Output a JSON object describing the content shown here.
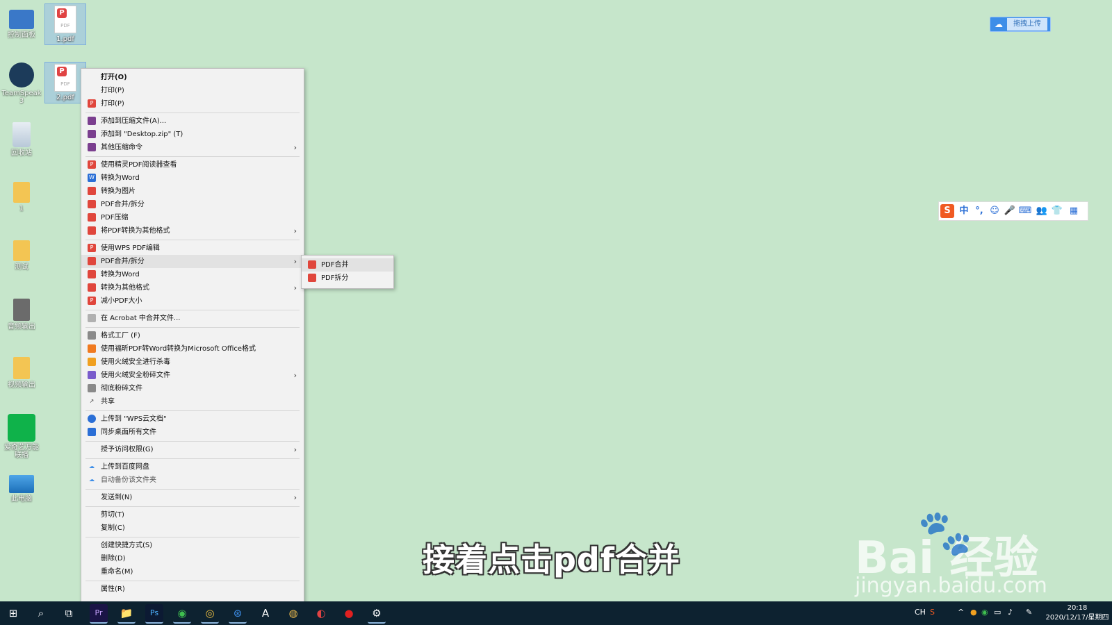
{
  "desktop_icons": [
    {
      "label": "控制面板",
      "icon": "control-panel-icon"
    },
    {
      "label": "1.pdf",
      "icon": "pdf-file-icon"
    },
    {
      "label": "TeamSpeak 3",
      "icon": "teamspeak-icon"
    },
    {
      "label": "2.pdf",
      "icon": "pdf-file-icon"
    },
    {
      "label": "回收站",
      "icon": "recycle-bin-icon"
    },
    {
      "label": "1",
      "icon": "folder-icon"
    },
    {
      "label": "测试",
      "icon": "folder-icon"
    },
    {
      "label": "音频输出",
      "icon": "folder-icon"
    },
    {
      "label": "视频输出",
      "icon": "folder-icon"
    },
    {
      "label": "爱奇艺万能联播",
      "icon": "iqiyi-icon"
    },
    {
      "label": "此电脑",
      "icon": "computer-icon"
    }
  ],
  "context_menu": {
    "items": [
      {
        "label": "打开(O)"
      },
      {
        "label": "打印(P)"
      },
      {
        "label": "打印(P)"
      },
      {
        "label": "添加到压缩文件(A)..."
      },
      {
        "label": "添加到 \"Desktop.zip\" (T)"
      },
      {
        "label": "其他压缩命令"
      },
      {
        "label": "使用精灵PDF阅读器查看"
      },
      {
        "label": "转换为Word"
      },
      {
        "label": "转换为图片"
      },
      {
        "label": "PDF合并/拆分"
      },
      {
        "label": "PDF压缩"
      },
      {
        "label": "将PDF转换为其他格式"
      },
      {
        "label": "使用WPS PDF编辑"
      },
      {
        "label": "PDF合并/拆分"
      },
      {
        "label": "转换为Word"
      },
      {
        "label": "转换为其他格式"
      },
      {
        "label": "减小PDF大小"
      },
      {
        "label": "在 Acrobat 中合并文件..."
      },
      {
        "label": "格式工厂 (F)"
      },
      {
        "label": "使用福昕PDF转Word转换为Microsoft Office格式"
      },
      {
        "label": "使用火绒安全进行杀毒"
      },
      {
        "label": "使用火绒安全粉碎文件"
      },
      {
        "label": "彻底粉碎文件"
      },
      {
        "label": "共享"
      },
      {
        "label": "上传到 \"WPS云文档\""
      },
      {
        "label": "同步桌面所有文件"
      },
      {
        "label": "授予访问权限(G)"
      },
      {
        "label": "上传到百度网盘"
      },
      {
        "label": "自动备份该文件夹"
      },
      {
        "label": "发送到(N)"
      },
      {
        "label": "剪切(T)"
      },
      {
        "label": "复制(C)"
      },
      {
        "label": "创建快捷方式(S)"
      },
      {
        "label": "删除(D)"
      },
      {
        "label": "重命名(M)"
      },
      {
        "label": "属性(R)"
      }
    ]
  },
  "submenu": {
    "items": [
      {
        "label": "PDF合并"
      },
      {
        "label": "PDF拆分"
      }
    ]
  },
  "cloud_upload": {
    "label": "拖拽上传"
  },
  "ime_toolbar": {
    "items": [
      "S",
      "中",
      "°,",
      "☺",
      "🎤",
      "⌨",
      "👥",
      "👕",
      "▦"
    ]
  },
  "caption": "接着点击pdf合并",
  "watermark": {
    "logo": "Bai  经验",
    "url": "jingyan.baidu.com"
  },
  "taskbar": {
    "apps": [
      "⊞",
      "⌕",
      "⧉",
      "Pr",
      "📁",
      "Ps",
      "◉",
      "◎",
      "⊛",
      "A",
      "◍",
      "◐",
      "●",
      "⚙"
    ],
    "tray": {
      "ime": "CH",
      "time": "20:18",
      "date": "2020/12/17/星期四"
    }
  }
}
